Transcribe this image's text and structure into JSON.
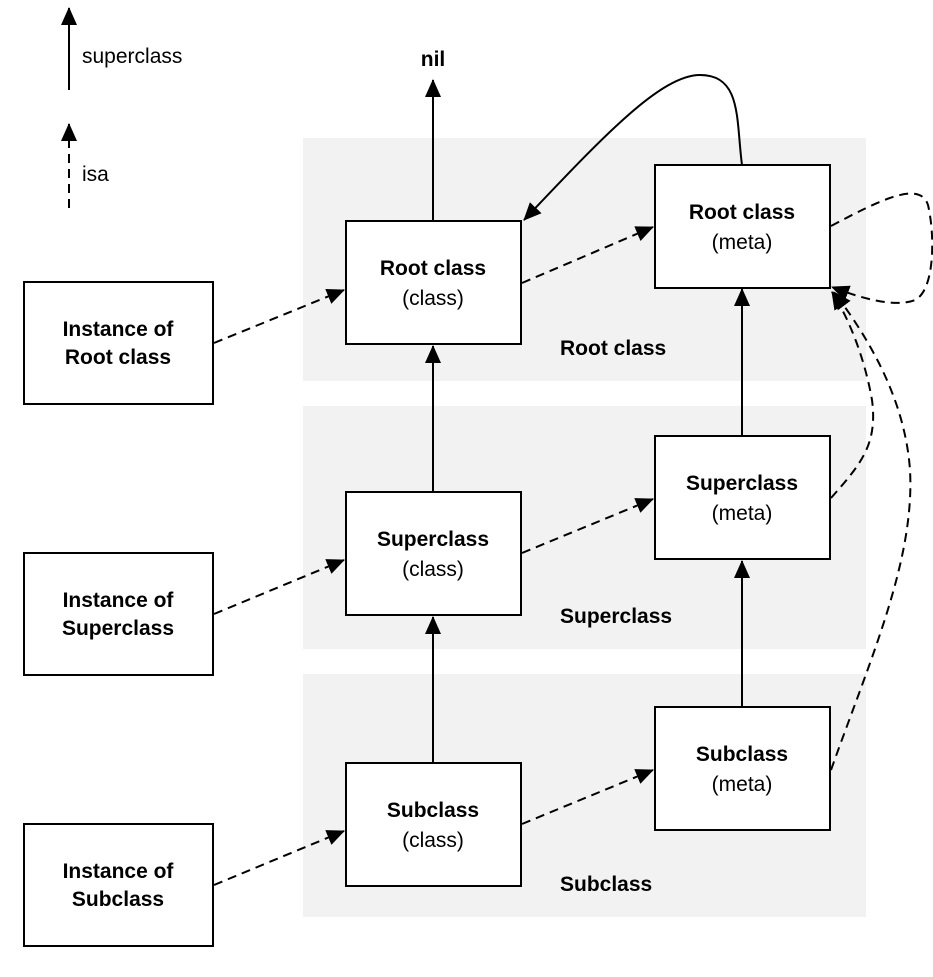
{
  "legend": {
    "superclass_label": "superclass",
    "isa_label": "isa"
  },
  "nil_label": "nil",
  "bands": {
    "root": "Root class",
    "super": "Superclass",
    "sub": "Subclass"
  },
  "instances": {
    "root": [
      "Instance of",
      "Root class"
    ],
    "super": [
      "Instance of",
      "Superclass"
    ],
    "sub": [
      "Instance of",
      "Subclass"
    ]
  },
  "classes": {
    "root": [
      "Root class",
      "(class)"
    ],
    "super": [
      "Superclass",
      "(class)"
    ],
    "sub": [
      "Subclass",
      "(class)"
    ]
  },
  "metas": {
    "root": [
      "Root class",
      "(meta)"
    ],
    "super": [
      "Superclass",
      "(meta)"
    ],
    "sub": [
      "Subclass",
      "(meta)"
    ]
  },
  "colors": {
    "band": "#f2f2f2",
    "stroke": "#000000"
  }
}
